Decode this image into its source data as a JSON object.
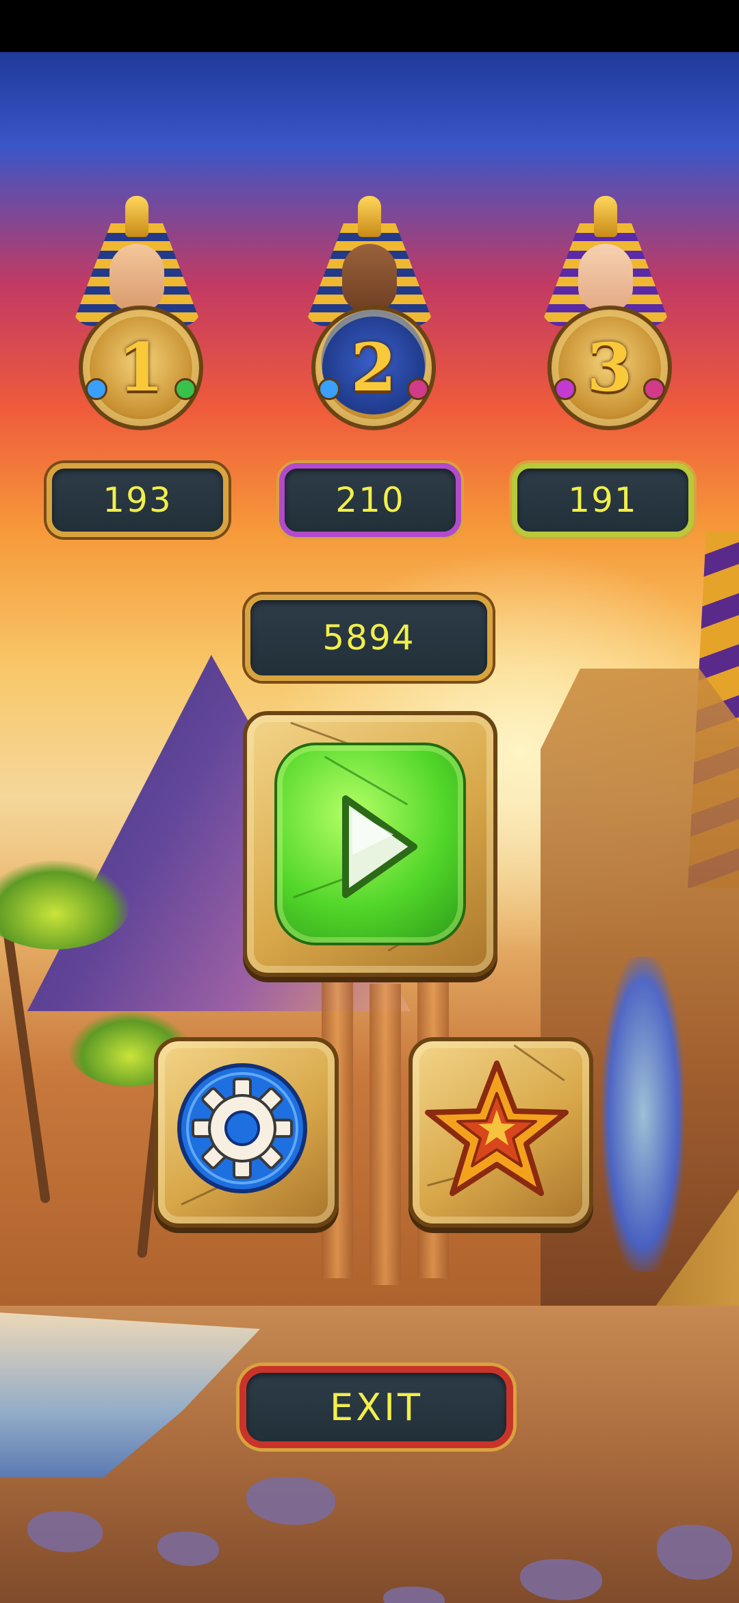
{
  "leaderboard": [
    {
      "rank": "1",
      "score": "193",
      "plate_border": "#d9a33e"
    },
    {
      "rank": "2",
      "score": "210",
      "plate_border": "#b24acb"
    },
    {
      "rank": "3",
      "score": "191",
      "plate_border": "#b9c93a"
    }
  ],
  "total_score": "5894",
  "buttons": {
    "play_icon": "play-icon",
    "settings_icon": "gear-icon",
    "favorites_icon": "star-icon",
    "exit_label": "EXIT"
  },
  "colors": {
    "score_text": "#f2ef4a",
    "plate_bg": "#2d3c48",
    "play_green": "#52d62a",
    "settings_blue": "#1e6fe0",
    "exit_border": "#c9342a"
  }
}
